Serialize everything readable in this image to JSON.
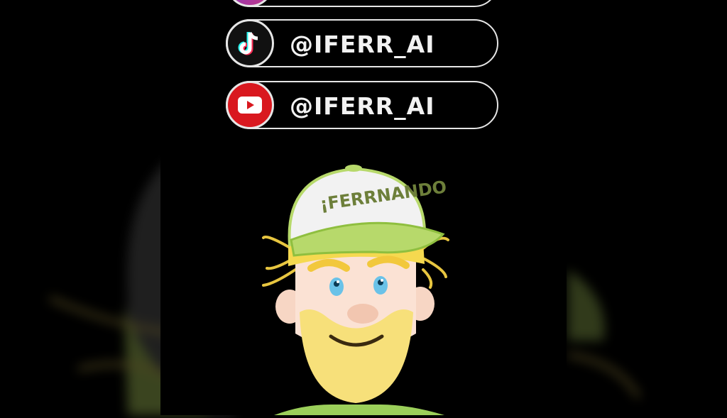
{
  "socials": [
    {
      "platform": "tiktok",
      "handle": "@IFERR_AI",
      "icon": "tiktok-icon",
      "icon_color": "#111111"
    },
    {
      "platform": "youtube",
      "handle": "@IFERR_AI",
      "icon": "youtube-icon",
      "icon_color": "#d9181f"
    }
  ],
  "cap_text": "¡FERRNANDO",
  "colors": {
    "background": "#000000",
    "pill_border": "#e6e6e6",
    "cap_green": "#b7d96b",
    "beard_yellow": "#f7e07a"
  }
}
